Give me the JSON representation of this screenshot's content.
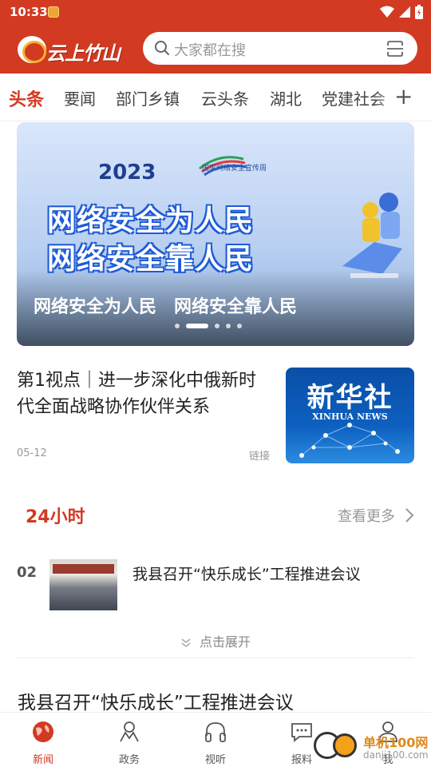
{
  "status": {
    "time": "10:33"
  },
  "header": {
    "app_name": "云上竹山",
    "search_placeholder": "大家都在搜"
  },
  "tabs": [
    {
      "label": "头条",
      "active": true
    },
    {
      "label": "要闻"
    },
    {
      "label": "部门乡镇"
    },
    {
      "label": "云头条"
    },
    {
      "label": "湖北"
    },
    {
      "label": "党建社会"
    }
  ],
  "banner": {
    "year": "2023",
    "week_title": "国家网络安全宣传周",
    "line1": "网络安全为人民",
    "line2": "网络安全靠人民",
    "caption": "网络安全为人民　网络安全靠人民",
    "slide_count": 5,
    "active_slide": 2
  },
  "article": {
    "title": "第1视点｜进一步深化中俄新时代全面战略协作伙伴关系",
    "date": "05-12",
    "tag": "链接",
    "thumb_cn": "新华社",
    "thumb_en": "XINHUA NEWS"
  },
  "section24": {
    "title": "24小时",
    "more": "查看更多",
    "items": [
      {
        "rank": "02",
        "title": "我县召开“快乐成长”工程推进会议"
      }
    ],
    "expand": "点击展开"
  },
  "feed": {
    "headline": "我县召开“快乐成长”工程推进会议"
  },
  "bottom_nav": [
    {
      "label": "新闻",
      "icon": "globe-icon",
      "active": true
    },
    {
      "label": "政务",
      "icon": "people-icon"
    },
    {
      "label": "视听",
      "icon": "headphones-icon"
    },
    {
      "label": "报料",
      "icon": "chat-icon"
    },
    {
      "label": "我",
      "icon": "user-icon"
    }
  ],
  "watermark": {
    "name": "单机100网",
    "url": "danji100.com"
  },
  "colors": {
    "brand": "#d23a22",
    "accent_orange": "#f0a431"
  }
}
